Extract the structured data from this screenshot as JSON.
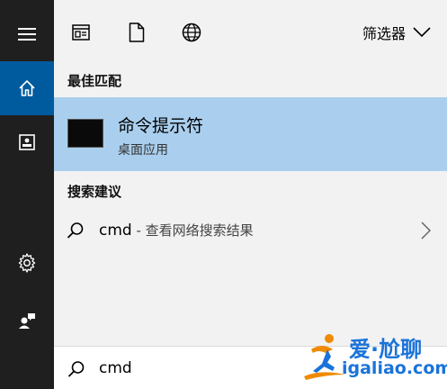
{
  "toolbar": {
    "filter_label": "筛选器",
    "icons": [
      "app-window-icon",
      "document-icon",
      "globe-icon"
    ]
  },
  "rail": {
    "icons": [
      "hamburger-menu-icon",
      "home-icon",
      "photo-book-icon",
      "settings-gear-icon",
      "user-feedback-icon"
    ],
    "active": "home-icon"
  },
  "best_match": {
    "heading": "最佳匹配",
    "name": "命令提示符",
    "type": "桌面应用"
  },
  "suggestions": {
    "heading": "搜索建议",
    "items": [
      {
        "term": "cmd",
        "suffix": " - 查看网络搜索结果"
      }
    ]
  },
  "search": {
    "value": "cmd"
  },
  "watermark": {
    "brand": "爱·尬聊",
    "url": "igaliao.com"
  },
  "colors": {
    "rail_bg": "#1f1f1f",
    "rail_active": "#005a9e",
    "highlight": "#aacfee",
    "panel_bg": "#f2f2f2",
    "brand": "#1a73d9",
    "brand_orange": "#f08a00"
  }
}
